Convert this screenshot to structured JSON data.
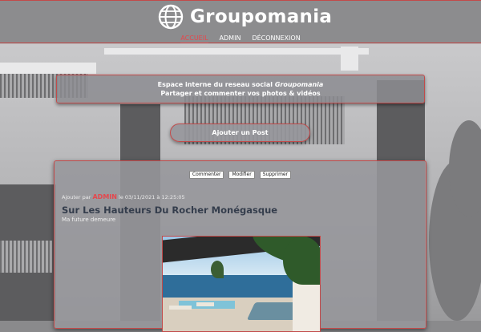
{
  "brand": {
    "name": "Groupomania",
    "logo_icon": "globe-icon"
  },
  "nav": {
    "items": [
      {
        "label": "ACCUEIL",
        "active": true
      },
      {
        "label": "ADMIN",
        "active": false
      },
      {
        "label": "DÉCONNEXION",
        "active": false
      }
    ]
  },
  "intro": {
    "line1_prefix": "Espace interne du reseau social ",
    "line1_brand": "Groupomania",
    "line2": "Partager et commenter vos photos & vidéos"
  },
  "add_post_label": "Ajouter un Post",
  "post": {
    "actions": {
      "comment": "Commenter",
      "edit": "Modifier",
      "delete": "Supprimer"
    },
    "added_by": "Ajouter par ",
    "author": "ADMIN",
    "date_text": " le 03/11/2021 à 12:25:05",
    "title": "Sur Les Hauteurs Du Rocher Monégasque",
    "description": "Ma future demeure"
  },
  "colors": {
    "accent": "#e5484d",
    "border": "#c24a4a",
    "title": "#343d4c"
  }
}
